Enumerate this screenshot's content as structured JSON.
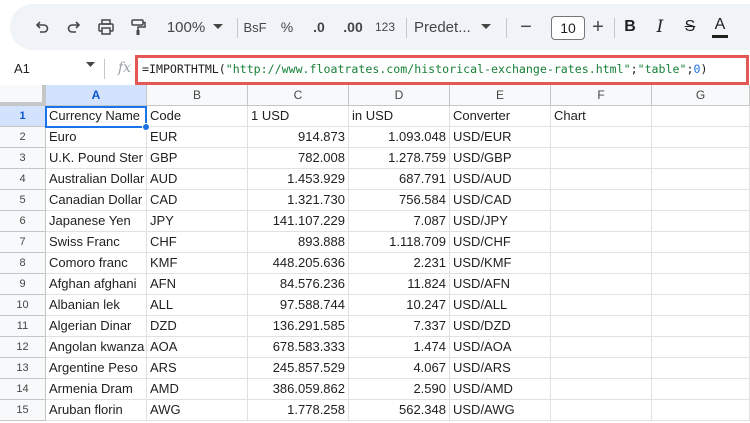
{
  "toolbar": {
    "zoom": "100%",
    "currency_format": "BsF",
    "percent_format": "%",
    "decrease_decimal": ".0",
    "increase_decimal": ".00",
    "number_format": "123",
    "font_name": "Predet...",
    "font_size": "10",
    "minus": "−",
    "plus": "+",
    "bold": "B",
    "italic": "I",
    "strikethrough": "S",
    "text_color": "A"
  },
  "formula_bar": {
    "cell_ref": "A1",
    "fx": "fx",
    "formula_prefix": "=IMPORTHTML(",
    "formula_url": "\"http://www.floatrates.com/historical-exchange-rates.html\"",
    "formula_sep1": ";",
    "formula_arg2": "\"table\"",
    "formula_sep2": ";",
    "formula_arg3": "0",
    "formula_suffix": ")"
  },
  "columns": [
    "A",
    "B",
    "C",
    "D",
    "E",
    "F",
    "G"
  ],
  "rows": [
    {
      "num": "1",
      "cells": [
        "Currency Name",
        "Code",
        "1 USD",
        "in USD",
        "Converter",
        "Chart"
      ]
    },
    {
      "num": "2",
      "cells": [
        "Euro",
        "EUR",
        "914.873",
        "1.093.048",
        "USD/EUR",
        ""
      ]
    },
    {
      "num": "3",
      "cells": [
        "U.K. Pound Ster",
        "GBP",
        "782.008",
        "1.278.759",
        "USD/GBP",
        ""
      ]
    },
    {
      "num": "4",
      "cells": [
        "Australian Dollar",
        "AUD",
        "1.453.929",
        "687.791",
        "USD/AUD",
        ""
      ]
    },
    {
      "num": "5",
      "cells": [
        "Canadian Dollar",
        "CAD",
        "1.321.730",
        "756.584",
        "USD/CAD",
        ""
      ]
    },
    {
      "num": "6",
      "cells": [
        "Japanese Yen",
        "JPY",
        "141.107.229",
        "7.087",
        "USD/JPY",
        ""
      ]
    },
    {
      "num": "7",
      "cells": [
        "Swiss Franc",
        "CHF",
        "893.888",
        "1.118.709",
        "USD/CHF",
        ""
      ]
    },
    {
      "num": "8",
      "cells": [
        "Comoro franc",
        "KMF",
        "448.205.636",
        "2.231",
        "USD/KMF",
        ""
      ]
    },
    {
      "num": "9",
      "cells": [
        "Afghan afghani",
        "AFN",
        "84.576.236",
        "11.824",
        "USD/AFN",
        ""
      ]
    },
    {
      "num": "10",
      "cells": [
        "Albanian lek",
        "ALL",
        "97.588.744",
        "10.247",
        "USD/ALL",
        ""
      ]
    },
    {
      "num": "11",
      "cells": [
        "Algerian Dinar",
        "DZD",
        "136.291.585",
        "7.337",
        "USD/DZD",
        ""
      ]
    },
    {
      "num": "12",
      "cells": [
        "Angolan kwanza",
        "AOA",
        "678.583.333",
        "1.474",
        "USD/AOA",
        ""
      ]
    },
    {
      "num": "13",
      "cells": [
        "Argentine Peso",
        "ARS",
        "245.857.529",
        "4.067",
        "USD/ARS",
        ""
      ]
    },
    {
      "num": "14",
      "cells": [
        "Armenia Dram",
        "AMD",
        "386.059.862",
        "2.590",
        "USD/AMD",
        ""
      ]
    },
    {
      "num": "15",
      "cells": [
        "Aruban florin",
        "AWG",
        "1.778.258",
        "562.348",
        "USD/AWG",
        ""
      ]
    }
  ],
  "colors": {
    "accent": "#1a73e8",
    "highlight_border": "#e45757",
    "toolbar_bg": "#f0f4f9"
  }
}
